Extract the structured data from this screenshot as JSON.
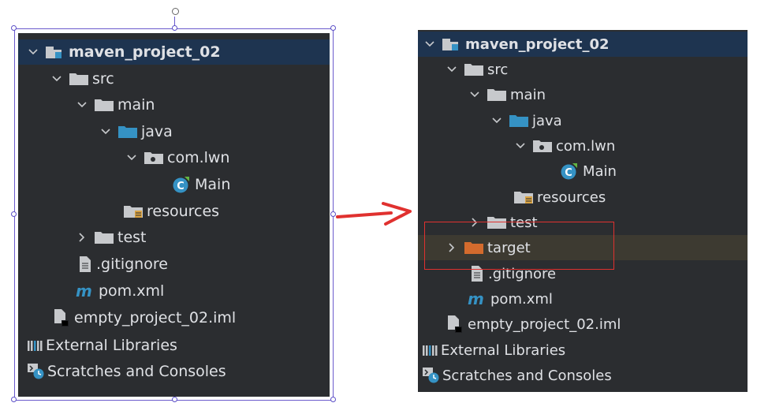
{
  "left_tree": {
    "root": "maven_project_02",
    "src": "src",
    "main": "main",
    "java": "java",
    "package": "com.lwn",
    "main_class": "Main",
    "resources": "resources",
    "test": "test",
    "gitignore": ".gitignore",
    "pom": "pom.xml",
    "iml": "empty_project_02.iml",
    "external_libraries": "External Libraries",
    "scratches": "Scratches and Consoles"
  },
  "right_tree": {
    "root": "maven_project_02",
    "src": "src",
    "main": "main",
    "java": "java",
    "package": "com.lwn",
    "main_class": "Main",
    "resources": "resources",
    "test": "test",
    "target": "target",
    "gitignore": ".gitignore",
    "pom": "pom.xml",
    "iml": "empty_project_02.iml",
    "external_libraries": "External Libraries",
    "scratches": "Scratches and Consoles"
  },
  "colors": {
    "panel_bg": "#2b2d30",
    "selected_row": "#1e3450",
    "highlighted_row": "#3d3a31",
    "folder_gray": "#c7c9cc",
    "folder_blue": "#3592c4",
    "folder_orange": "#d46b2d",
    "annotation_red": "#e0312f",
    "text": "#dfe1e5"
  },
  "icons": {
    "chevron_down": "chevron-down-icon",
    "chevron_right": "chevron-right-icon",
    "module": "module-icon",
    "folder": "folder-icon",
    "source_folder": "source-folder-icon",
    "package": "package-icon",
    "class": "class-icon",
    "resources": "resources-folder-icon",
    "excluded_folder": "excluded-folder-icon",
    "file": "file-icon",
    "maven": "maven-icon",
    "iml": "iml-file-icon",
    "libraries": "libraries-icon",
    "scratches": "scratches-icon"
  }
}
